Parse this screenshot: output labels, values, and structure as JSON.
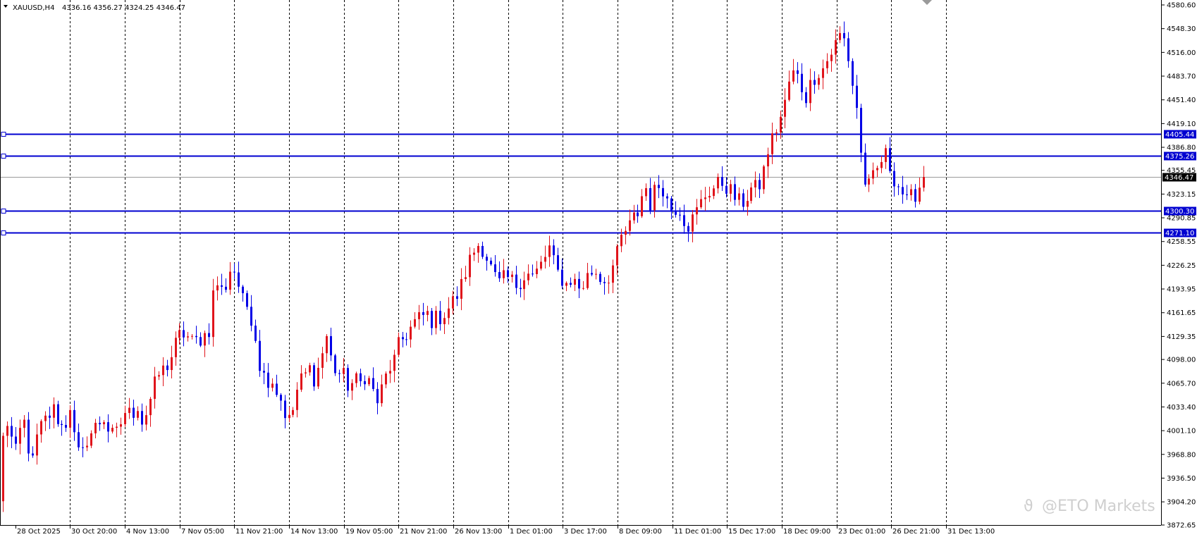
{
  "header": {
    "symbol": "XAUUSD,H4",
    "ohlc": "4336.16 4356.27 4324.25 4346.47"
  },
  "watermark": "@ETO Markets",
  "colors": {
    "background": "#ffffff",
    "bull": "#e0141b",
    "bear": "#0000e6",
    "hline": "#0000d0",
    "bid": "#9a9a9a"
  },
  "chart_data": {
    "type": "candlestick",
    "title": "XAUUSD,H4",
    "grid": "vertical dotted at time labels",
    "ylim": [
      3872.65,
      4580.6
    ],
    "y_ticks": [
      "4580.60",
      "4548.30",
      "4516.00",
      "4483.70",
      "4451.40",
      "4419.10",
      "4386.80",
      "4355.45",
      "4323.15",
      "4290.85",
      "4258.55",
      "4226.25",
      "4193.95",
      "4161.65",
      "4129.35",
      "4098.00",
      "4065.70",
      "4033.40",
      "4001.10",
      "3968.80",
      "3936.50",
      "3904.20",
      "3872.65"
    ],
    "x_labels": [
      "28 Oct 2025",
      "30 Oct 20:00",
      "4 Nov 13:00",
      "7 Nov 05:00",
      "11 Nov 21:00",
      "14 Nov 13:00",
      "19 Nov 05:00",
      "21 Nov 21:00",
      "26 Nov 13:00",
      "1 Dec 01:00",
      "3 Dec 17:00",
      "8 Dec 09:00",
      "11 Dec 01:00",
      "15 Dec 17:00",
      "18 Dec 09:00",
      "23 Dec 01:00",
      "26 Dec 21:00",
      "31 Dec 13:00"
    ],
    "horizontal_levels": [
      "4405.44",
      "4375.26",
      "4300.30",
      "4271.10"
    ],
    "current_price": "4346.47",
    "close_path": [
      3990,
      4020,
      3960,
      4000,
      4015,
      3945,
      3990,
      4010,
      4020,
      4030,
      4015,
      4000,
      4040,
      3980,
      3960,
      3990,
      4000,
      4010,
      4020,
      4000,
      3990,
      4010,
      4030,
      4020,
      4040,
      4010,
      4035,
      4060,
      4080,
      4085,
      4100,
      4120,
      4135,
      4130,
      4120,
      4125,
      4130,
      4140,
      4210,
      4190,
      4200,
      4230,
      4205,
      4175,
      4170,
      4140,
      4090,
      4070,
      4075,
      4055,
      4040,
      4010,
      4030,
      4065,
      4075,
      4085,
      4070,
      4100,
      4130,
      4090,
      4080,
      4075,
      4060,
      4070,
      4065,
      4080,
      4060,
      4040,
      4060,
      4085,
      4095,
      4120,
      4130,
      4140,
      4150,
      4155,
      4160,
      4150,
      4155,
      4160,
      4170,
      4180,
      4195,
      4220,
      4240,
      4255,
      4250,
      4230,
      4210,
      4200,
      4210,
      4205,
      4200,
      4210,
      4215,
      4210,
      4220,
      4235,
      4250,
      4220,
      4210,
      4200,
      4210,
      4195,
      4200,
      4215,
      4220,
      4210,
      4205,
      4220,
      4240,
      4270,
      4275,
      4290,
      4300,
      4340,
      4310,
      4330,
      4340,
      4315,
      4300,
      4310,
      4290,
      4280,
      4295,
      4310,
      4325,
      4330,
      4335,
      4340,
      4330,
      4320,
      4310,
      4315,
      4330,
      4330,
      4340,
      4380,
      4400,
      4420,
      4440,
      4480,
      4490,
      4470,
      4455,
      4480,
      4490,
      4495,
      4510,
      4525,
      4540,
      4530,
      4480,
      4440,
      4350,
      4330,
      4345,
      4360,
      4380,
      4360,
      4340,
      4330,
      4310,
      4320,
      4330,
      4346.47
    ]
  }
}
